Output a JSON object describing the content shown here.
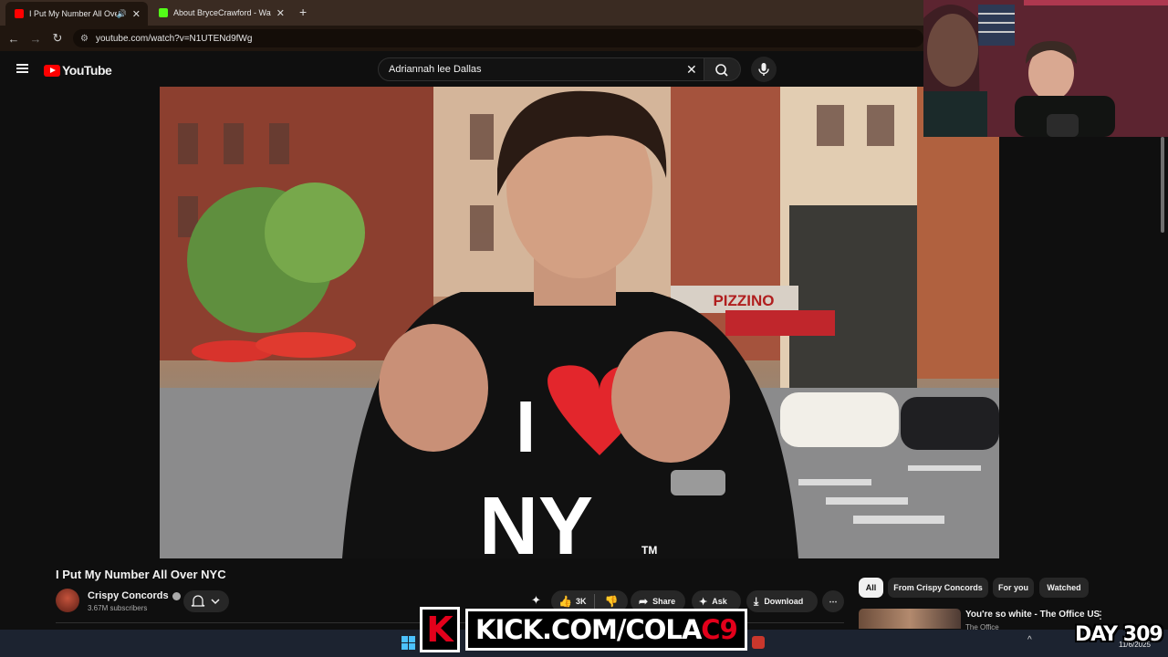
{
  "browser": {
    "tabs": [
      {
        "title": "I Put My Number All Over N",
        "favicon_color": "#ff0000",
        "active": true,
        "audio": true
      },
      {
        "title": "About BryceCrawford - Watch",
        "favicon_color": "#53fc18",
        "active": false,
        "audio": false
      }
    ],
    "close_glyph": "✕",
    "new_tab_glyph": "+",
    "url": "youtube.com/watch?v=N1UTENd9fWg"
  },
  "youtube": {
    "logo_text": "YouTube",
    "search": {
      "value": "Adriannah lee Dallas",
      "clear_glyph": "✕"
    },
    "video": {
      "shirt_text_top": "I",
      "shirt_text_bottom": "NY",
      "shirt_tm": "TM",
      "sign_text": "PIZZINO"
    },
    "title": "I Put My Number All Over NYC",
    "channel": {
      "name": "Crispy Concords",
      "subscribers": "3.67M subscribers"
    },
    "actions": {
      "like_count": "3K",
      "share_label": "Share",
      "ask_label": "Ask",
      "download_label": "Download",
      "more_glyph": "⋯"
    },
    "chips": [
      "All",
      "From Crispy Concords",
      "For you",
      "Watched"
    ],
    "recommendation": {
      "title": "You're so white - The Office US",
      "channel": "The Office"
    }
  },
  "overlay": {
    "kick_logo": "K",
    "kick_text_main": "KICK.COM/COLA",
    "kick_text_accent": "C9",
    "day_counter": "DAY  309"
  },
  "taskbar": {
    "date": "11/6/2025"
  },
  "colors": {
    "youtube_red": "#ff0000",
    "kick_green": "#53fc18",
    "accent_blue": "#4cc2ff"
  }
}
